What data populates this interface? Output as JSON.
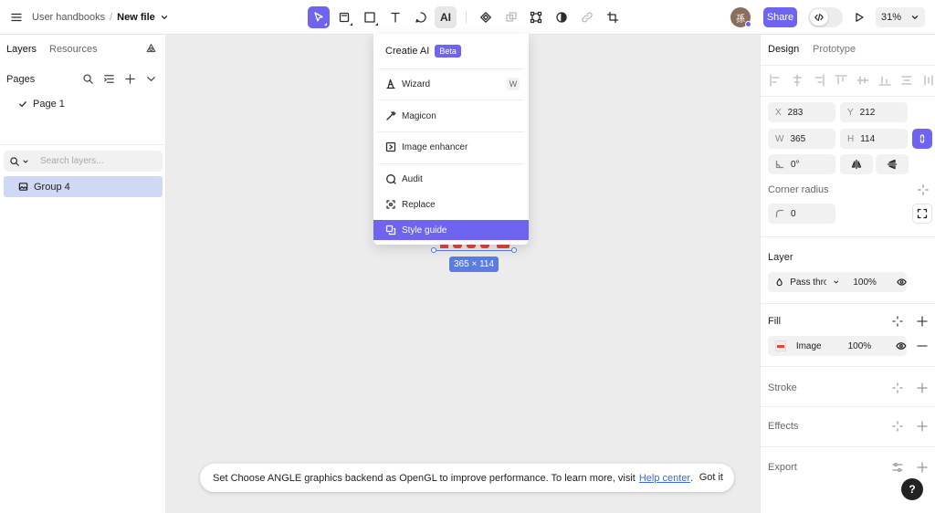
{
  "header": {
    "breadcrumb_root": "User handbooks",
    "breadcrumb_sep": "/",
    "file_name": "New file",
    "ai_tool_label": "AI",
    "avatar_initial": "孫",
    "share_label": "Share",
    "zoom_level": "31%",
    "accent_color": "#6e64f0"
  },
  "left_panel": {
    "tabs": [
      "Layers",
      "Resources"
    ],
    "pages_title": "Pages",
    "pages": [
      {
        "label": "Page 1",
        "current": true
      }
    ],
    "search_placeholder": "Search layers...",
    "layers": [
      {
        "label": "Group 4",
        "selected": true
      }
    ]
  },
  "canvas": {
    "selection_size": "365 × 114"
  },
  "ai_menu": {
    "title": "Creatie AI",
    "badge": "Beta",
    "items": [
      {
        "label": "Wizard",
        "shortcut": "W",
        "icon": "wizard-hat-icon"
      },
      {
        "label": "Magicon",
        "icon": "magic-brush-icon"
      },
      {
        "label": "Image enhancer",
        "icon": "image-enhance-icon"
      },
      {
        "label": "Audit",
        "icon": "audit-icon"
      },
      {
        "label": "Replace",
        "icon": "replace-icon"
      },
      {
        "label": "Style guide",
        "icon": "style-guide-icon",
        "highlighted": true
      }
    ]
  },
  "toast": {
    "message": "Set Choose ANGLE graphics backend as OpenGL to improve performance. To learn more, visit",
    "link": "Help center",
    "suffix": ".",
    "action": "Got it"
  },
  "design_panel": {
    "tabs": [
      "Design",
      "Prototype"
    ],
    "x_label": "X",
    "x": "283",
    "y_label": "Y",
    "y": "212",
    "w_label": "W",
    "w": "365",
    "h_label": "H",
    "h": "114",
    "rotation": "0°",
    "corner_radius_title": "Corner radius",
    "corner_radius": "0",
    "layer_title": "Layer",
    "blend_mode": "Pass thro",
    "layer_opacity": "100%",
    "fill_title": "Fill",
    "fill_type": "Image",
    "fill_opacity": "100%",
    "stroke_title": "Stroke",
    "effects_title": "Effects",
    "export_title": "Export",
    "help_label": "?"
  }
}
